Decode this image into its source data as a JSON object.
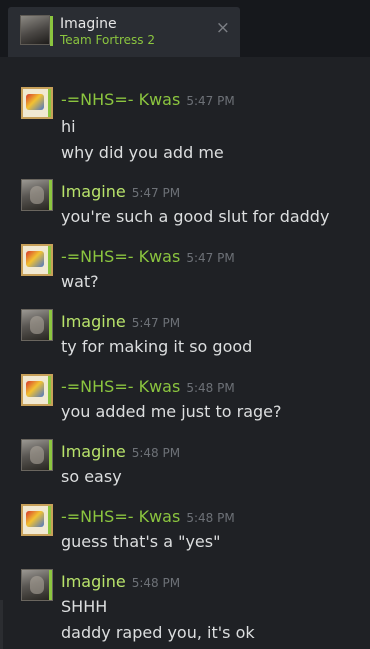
{
  "tab": {
    "name": "Imagine",
    "game": "Team Fortress 2",
    "close_icon": "×"
  },
  "messages": [
    {
      "sender": "-=NHS=- Kwas",
      "time": "5:47 PM",
      "avatar": "poptart-avatar",
      "lines": [
        "hi",
        "why did you add me"
      ]
    },
    {
      "sender": "Imagine",
      "time": "5:47 PM",
      "avatar": "face-avatar",
      "lines": [
        "you're such a good slut for daddy"
      ]
    },
    {
      "sender": "-=NHS=- Kwas",
      "time": "5:47 PM",
      "avatar": "poptart-avatar",
      "lines": [
        "wat?"
      ]
    },
    {
      "sender": "Imagine",
      "time": "5:47 PM",
      "avatar": "face-avatar",
      "lines": [
        "ty for making it so good"
      ]
    },
    {
      "sender": "-=NHS=- Kwas",
      "time": "5:48 PM",
      "avatar": "poptart-avatar",
      "lines": [
        "you added me just to rage?"
      ]
    },
    {
      "sender": "Imagine",
      "time": "5:48 PM",
      "avatar": "face-avatar",
      "lines": [
        "so easy"
      ]
    },
    {
      "sender": "-=NHS=- Kwas",
      "time": "5:48 PM",
      "avatar": "poptart-avatar",
      "lines": [
        "guess that's a \"yes\""
      ]
    },
    {
      "sender": "Imagine",
      "time": "5:48 PM",
      "avatar": "face-avatar",
      "lines": [
        "SHHH",
        "daddy raped you, it's ok"
      ]
    }
  ],
  "colors": {
    "background": "#1f2125",
    "online_green": "#8bc53f",
    "text": "#dcdedf",
    "timestamp": "#6d7177"
  }
}
